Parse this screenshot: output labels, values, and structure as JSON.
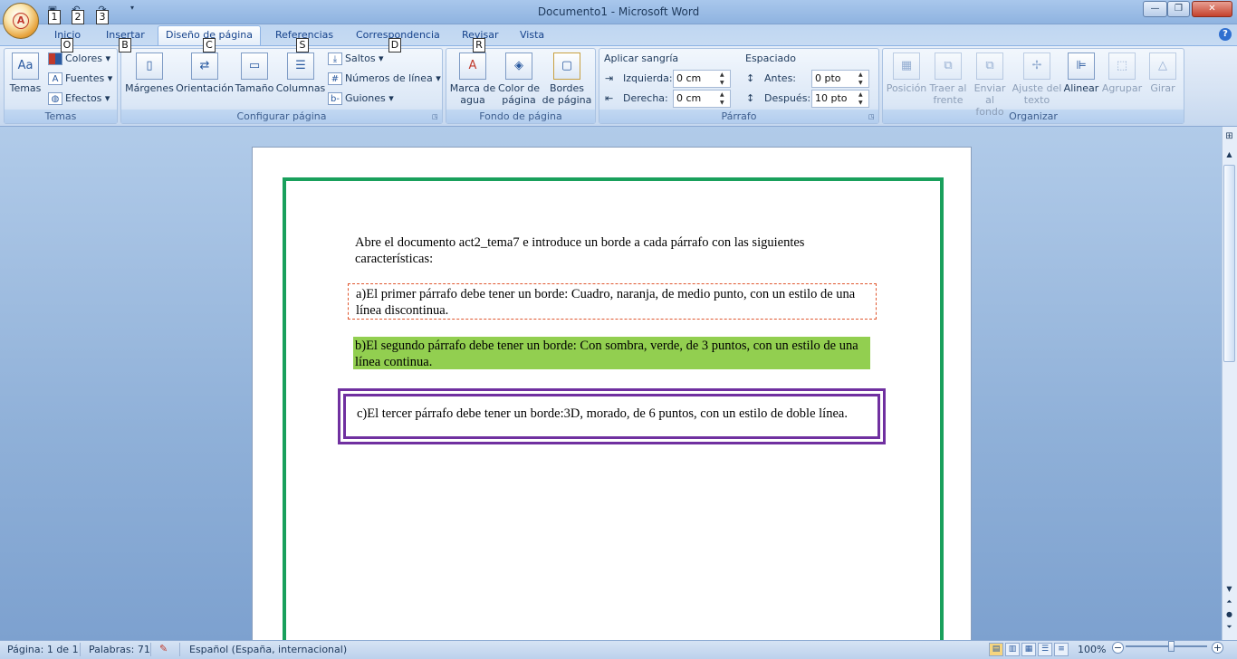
{
  "window": {
    "title": "Documento1 - Microsoft Word"
  },
  "keytips": {
    "qat1": "1",
    "qat2": "2",
    "qat3": "3",
    "temas": "O",
    "configurar": "B",
    "orientacion": "C",
    "saltos": "S",
    "numeros": "D",
    "marca": "R"
  },
  "tabs": [
    {
      "label": "Inicio"
    },
    {
      "label": "Insertar"
    },
    {
      "label": "Diseño de página"
    },
    {
      "label": "Referencias"
    },
    {
      "label": "Correspondencia"
    },
    {
      "label": "Revisar"
    },
    {
      "label": "Vista"
    }
  ],
  "ribbon": {
    "temas": {
      "label": "Temas",
      "big": "Temas",
      "colores": "Colores",
      "fuentes": "Fuentes",
      "efectos": "Efectos"
    },
    "configurar": {
      "label": "Configurar página",
      "margenes": "Márgenes",
      "orientacion": "Orientación",
      "tamano": "Tamaño",
      "columnas": "Columnas",
      "saltos": "Saltos",
      "numeros": "Números de línea",
      "guiones": "Guiones"
    },
    "fondo": {
      "label": "Fondo de página",
      "marca1": "Marca de",
      "marca2": "agua",
      "color1": "Color de",
      "color2": "página",
      "bordes1": "Bordes",
      "bordes2": "de página"
    },
    "parrafo": {
      "label": "Párrafo",
      "sangria": "Aplicar sangría",
      "izquierda": "Izquierda:",
      "izquierda_val": "0 cm",
      "derecha": "Derecha:",
      "derecha_val": "0 cm",
      "espaciado": "Espaciado",
      "antes": "Antes:",
      "antes_val": "0 pto",
      "despues": "Después:",
      "despues_val": "10 pto"
    },
    "organizar": {
      "label": "Organizar",
      "posicion": "Posición",
      "traer1": "Traer al",
      "traer2": "frente",
      "enviar1": "Enviar al",
      "enviar2": "fondo",
      "ajuste1": "Ajuste del",
      "ajuste2": "texto",
      "alinear": "Alinear",
      "agrupar": "Agrupar",
      "girar": "Girar"
    }
  },
  "document": {
    "intro": "Abre el documento act2_tema7 e introduce un borde a cada párrafo con las siguientes características:",
    "par_a": "a)El primer párrafo debe tener un borde: Cuadro, naranja, de medio punto, con un estilo de una línea discontinua.",
    "par_b": "b)El segundo párrafo debe tener un borde: Con sombra, verde, de 3 puntos, con un estilo de una línea continua.",
    "par_c": "c)El tercer párrafo debe tener un borde:3D, morado, de 6 puntos, con un estilo de doble línea."
  },
  "status": {
    "pagina": "Página: 1 de 1",
    "palabras": "Palabras: 71",
    "idioma": "Español (España, internacional)",
    "zoom": "100%",
    "zoom_level": 1.0
  },
  "colors": {
    "page_border": "#19a05c",
    "par_a_border": "#e0572f",
    "par_b_shading": "#92cf50",
    "par_c_border": "#7030a0"
  }
}
